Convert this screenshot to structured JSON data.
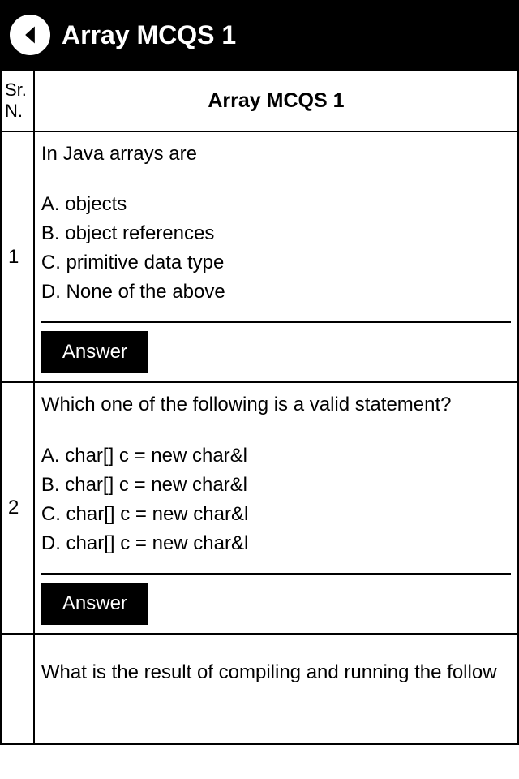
{
  "header": {
    "title": "Array MCQS 1"
  },
  "table": {
    "header": {
      "sr_label": "Sr. N.",
      "title": "Array MCQS 1"
    },
    "rows": [
      {
        "sr": "1",
        "question": "In Java arrays are",
        "options": [
          "A. objects",
          "B. object references",
          "C. primitive data type",
          "D. None of the above"
        ],
        "answer_label": "Answer"
      },
      {
        "sr": "2",
        "question": "Which one of the following is a valid statement?",
        "options": [
          "A. char[] c = new char&l",
          "B. char[] c = new char&l",
          "C. char[] c = new char&l",
          "D. char[] c = new char&l"
        ],
        "answer_label": "Answer"
      },
      {
        "sr": "",
        "question": "What is the result of compiling and running the follow",
        "options": [],
        "answer_label": ""
      }
    ]
  }
}
